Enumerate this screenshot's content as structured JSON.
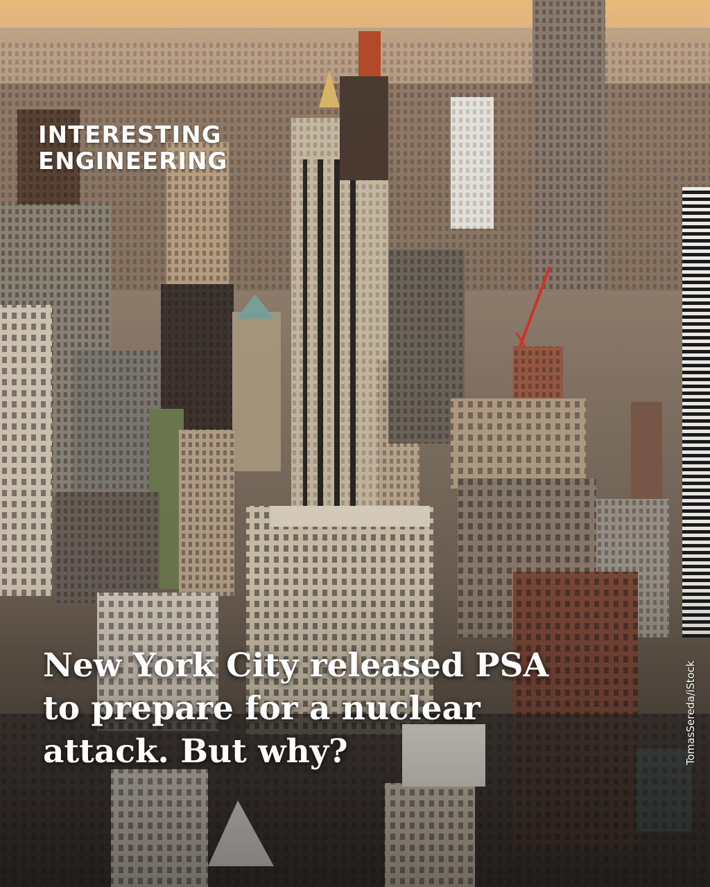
{
  "brand": {
    "line1": "INTERESTING",
    "line2": "ENGINEERING"
  },
  "headline": {
    "line1": "New York City released PSA",
    "line2": "to prepare for a nuclear",
    "line3": "attack. But why?"
  },
  "credit": "TomasSereda/iStock",
  "colors": {
    "highlight": "#1f8be0",
    "text": "#ffffff"
  }
}
